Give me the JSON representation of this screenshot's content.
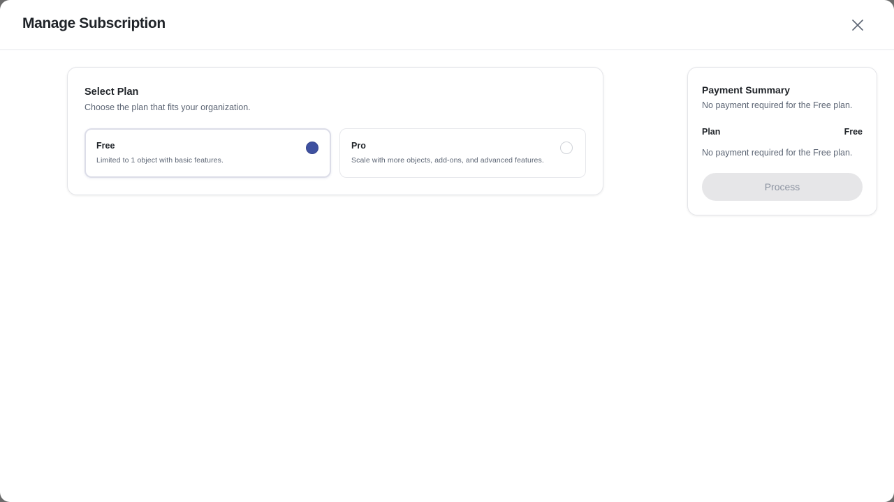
{
  "dialog": {
    "title": "Manage Subscription",
    "close_icon": "close-icon"
  },
  "select_plan": {
    "title": "Select Plan",
    "subtitle": "Choose the plan that fits your organization.",
    "selected": "Free",
    "options": [
      {
        "name": "Free",
        "description": "Limited to 1 object with basic features.",
        "selected": true
      },
      {
        "name": "Pro",
        "description": "Scale with more objects, add-ons, and advanced features.",
        "selected": false
      }
    ]
  },
  "payment_summary": {
    "title": "Payment Summary",
    "note_top": "No payment required for the Free plan.",
    "plan_label": "Plan",
    "plan_value": "Free",
    "note_bottom": "No payment required for the Free plan.",
    "button_label": "Process",
    "button_disabled": true
  },
  "colors": {
    "accent": "#3f51a0",
    "text_primary": "#1f2328",
    "text_secondary": "#5b6473",
    "border": "#e4e5e9",
    "button_disabled_bg": "#e6e6e8",
    "button_disabled_text": "#8b92a0"
  }
}
